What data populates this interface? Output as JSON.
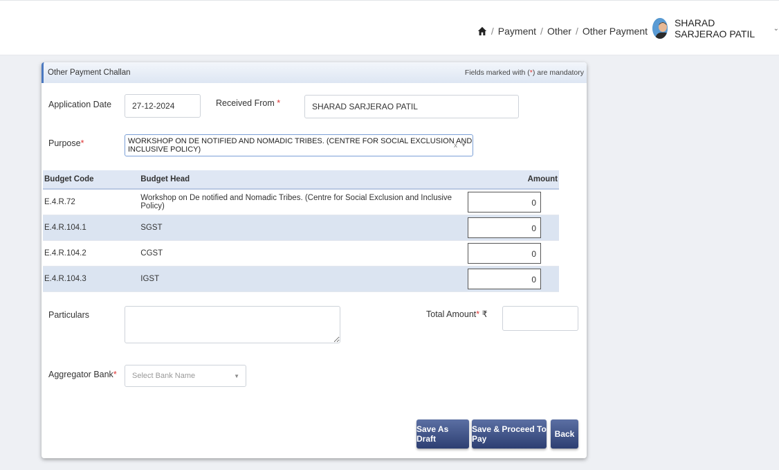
{
  "breadcrumb": {
    "items": [
      "Payment",
      "Other",
      "Other Payment"
    ],
    "separator": "/"
  },
  "user": {
    "name": "SHARAD SARJERAO PATIL"
  },
  "card": {
    "title": "Other Payment Challan",
    "mandatory_prefix": "Fields marked with (",
    "mandatory_star": "*",
    "mandatory_suffix": ") are mandatory"
  },
  "form": {
    "application_date_label": "Application Date",
    "application_date_value": "27-12-2024",
    "received_from_label": "Received From",
    "received_from_value": "SHARAD SARJERAO PATIL",
    "purpose_label": "Purpose",
    "purpose_value": "WORKSHOP ON DE NOTIFIED AND NOMADIC TRIBES. (CENTRE FOR SOCIAL EXCLUSION AND INCLUSIVE POLICY)",
    "particulars_label": "Particulars",
    "particulars_value": "",
    "total_amount_label": "Total Amount",
    "currency_symbol": "₹",
    "total_amount_value": "",
    "aggregator_bank_label": "Aggregator Bank",
    "aggregator_bank_placeholder": "Select Bank Name",
    "required_star": "*"
  },
  "budget_table": {
    "headers": {
      "code": "Budget Code",
      "head": "Budget Head",
      "amount": "Amount"
    },
    "rows": [
      {
        "code": "E.4.R.72",
        "head": "Workshop on De notified and Nomadic Tribes. (Centre for Social Exclusion and Inclusive Policy)",
        "amount": "0"
      },
      {
        "code": "E.4.R.104.1",
        "head": "SGST",
        "amount": "0"
      },
      {
        "code": "E.4.R.104.2",
        "head": "CGST",
        "amount": "0"
      },
      {
        "code": "E.4.R.104.3",
        "head": "IGST",
        "amount": "0"
      }
    ]
  },
  "buttons": {
    "save_draft": "Save As Draft",
    "save_proceed": "Save & Proceed To Pay",
    "back": "Back"
  },
  "icons": {
    "clear": "x",
    "dropdown": "▼",
    "user_caret": "⌄"
  },
  "colors": {
    "button_top": "#5b6fa3",
    "button_bottom": "#2d3f72",
    "required": "#dd3333",
    "header_band": "#dfe7f4"
  }
}
